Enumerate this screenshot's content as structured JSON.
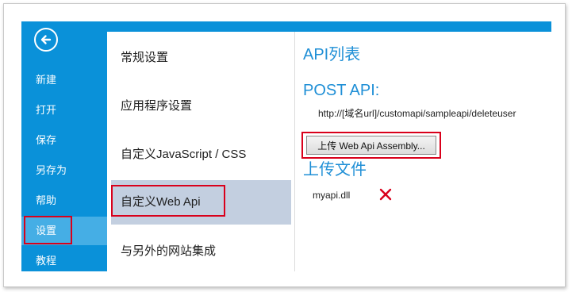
{
  "nav": {
    "back_icon": "back-arrow-icon",
    "items": [
      {
        "label": "新建"
      },
      {
        "label": "打开"
      },
      {
        "label": "保存"
      },
      {
        "label": "另存为"
      },
      {
        "label": "帮助"
      },
      {
        "label": "设置"
      },
      {
        "label": "教程"
      }
    ],
    "active": "设置"
  },
  "settings_menu": {
    "items": [
      {
        "label": "常规设置"
      },
      {
        "label": "应用程序设置"
      },
      {
        "label": "自定义JavaScript / CSS"
      },
      {
        "label": "自定义Web Api"
      },
      {
        "label": "与另外的网站集成"
      }
    ],
    "active": "自定义Web Api"
  },
  "panel": {
    "api_list_title": "API列表",
    "post_api_title": "POST API:",
    "post_api_url": "http://[域名url]/customapi/sampleapi/deleteuser",
    "upload_button_label": "上传 Web Api Assembly...",
    "uploaded_files_title": "上传文件",
    "files": [
      {
        "name": "myapi.dll",
        "action_icon": "delete-x-icon"
      }
    ]
  },
  "colors": {
    "accent": "#0a91d9",
    "nav_active": "#45aee5",
    "menu_active": "#c3cfe0",
    "heading": "#1f8fd6",
    "highlight_box": "#d9001b",
    "delete": "#d9001b"
  }
}
